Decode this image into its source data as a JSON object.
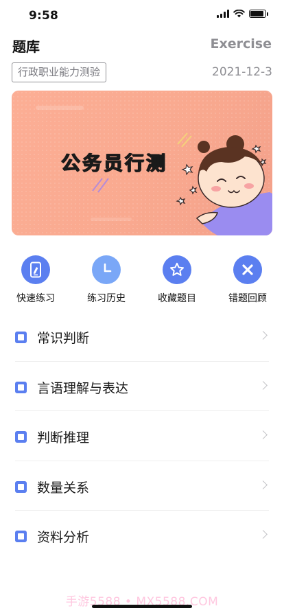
{
  "status_bar": {
    "time": "9:58",
    "battery_level": 0.9
  },
  "header": {
    "title": "题库",
    "title_en": "Exercise",
    "subject": "行政职业能力测验",
    "date": "2021-12-3"
  },
  "banner": {
    "title": "公务员行测",
    "background_color": "#fcae95",
    "illustration": "cartoon-girl"
  },
  "actions": [
    {
      "label": "快速练习",
      "icon": "phone-edit-icon",
      "color": "#5b7ff0"
    },
    {
      "label": "练习历史",
      "icon": "clock-icon",
      "color": "#7aa7f7"
    },
    {
      "label": "收藏题目",
      "icon": "star-icon",
      "color": "#5b7ff0"
    },
    {
      "label": "错题回顾",
      "icon": "close-x-icon",
      "color": "#5b7ff0"
    }
  ],
  "categories": [
    {
      "label": "常识判断"
    },
    {
      "label": "言语理解与表达"
    },
    {
      "label": "判断推理"
    },
    {
      "label": "数量关系"
    },
    {
      "label": "资料分析"
    }
  ],
  "colors": {
    "accent": "#5b7ff0",
    "muted_text": "#8e8e93",
    "divider": "#ededed"
  },
  "watermark": "手游5588 • MX5588.COM"
}
